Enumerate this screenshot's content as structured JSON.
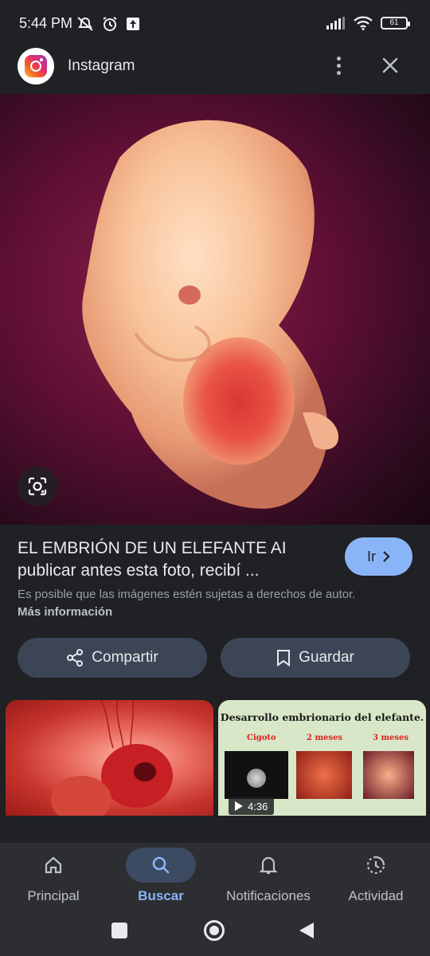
{
  "status_bar": {
    "time": "5:44 PM",
    "battery": "61"
  },
  "app": {
    "name": "Instagram"
  },
  "result": {
    "title": "EL EMBRIÓN DE UN ELEFANTE AI publicar antes esta foto, recibí ...",
    "go_label": "Ir",
    "copyright_text": "Es posible que las imágenes estén sujetas a derechos de autor.",
    "more_info_label": "Más información"
  },
  "actions": {
    "share_label": "Compartir",
    "save_label": "Guardar"
  },
  "related": [
    {
      "kind": "image"
    },
    {
      "kind": "video",
      "title": "Desarrollo embrionario del elefante.",
      "captions": [
        "Cigoto",
        "2 meses",
        "3 meses"
      ],
      "duration": "4:36"
    }
  ],
  "bottom_nav": [
    {
      "label": "Principal",
      "icon": "home-icon"
    },
    {
      "label": "Buscar",
      "icon": "search-icon",
      "active": true
    },
    {
      "label": "Notificaciones",
      "icon": "bell-icon"
    },
    {
      "label": "Actividad",
      "icon": "history-icon"
    }
  ],
  "colors": {
    "background": "#202124",
    "accent": "#8ab4f8",
    "pill": "#3c4555"
  }
}
